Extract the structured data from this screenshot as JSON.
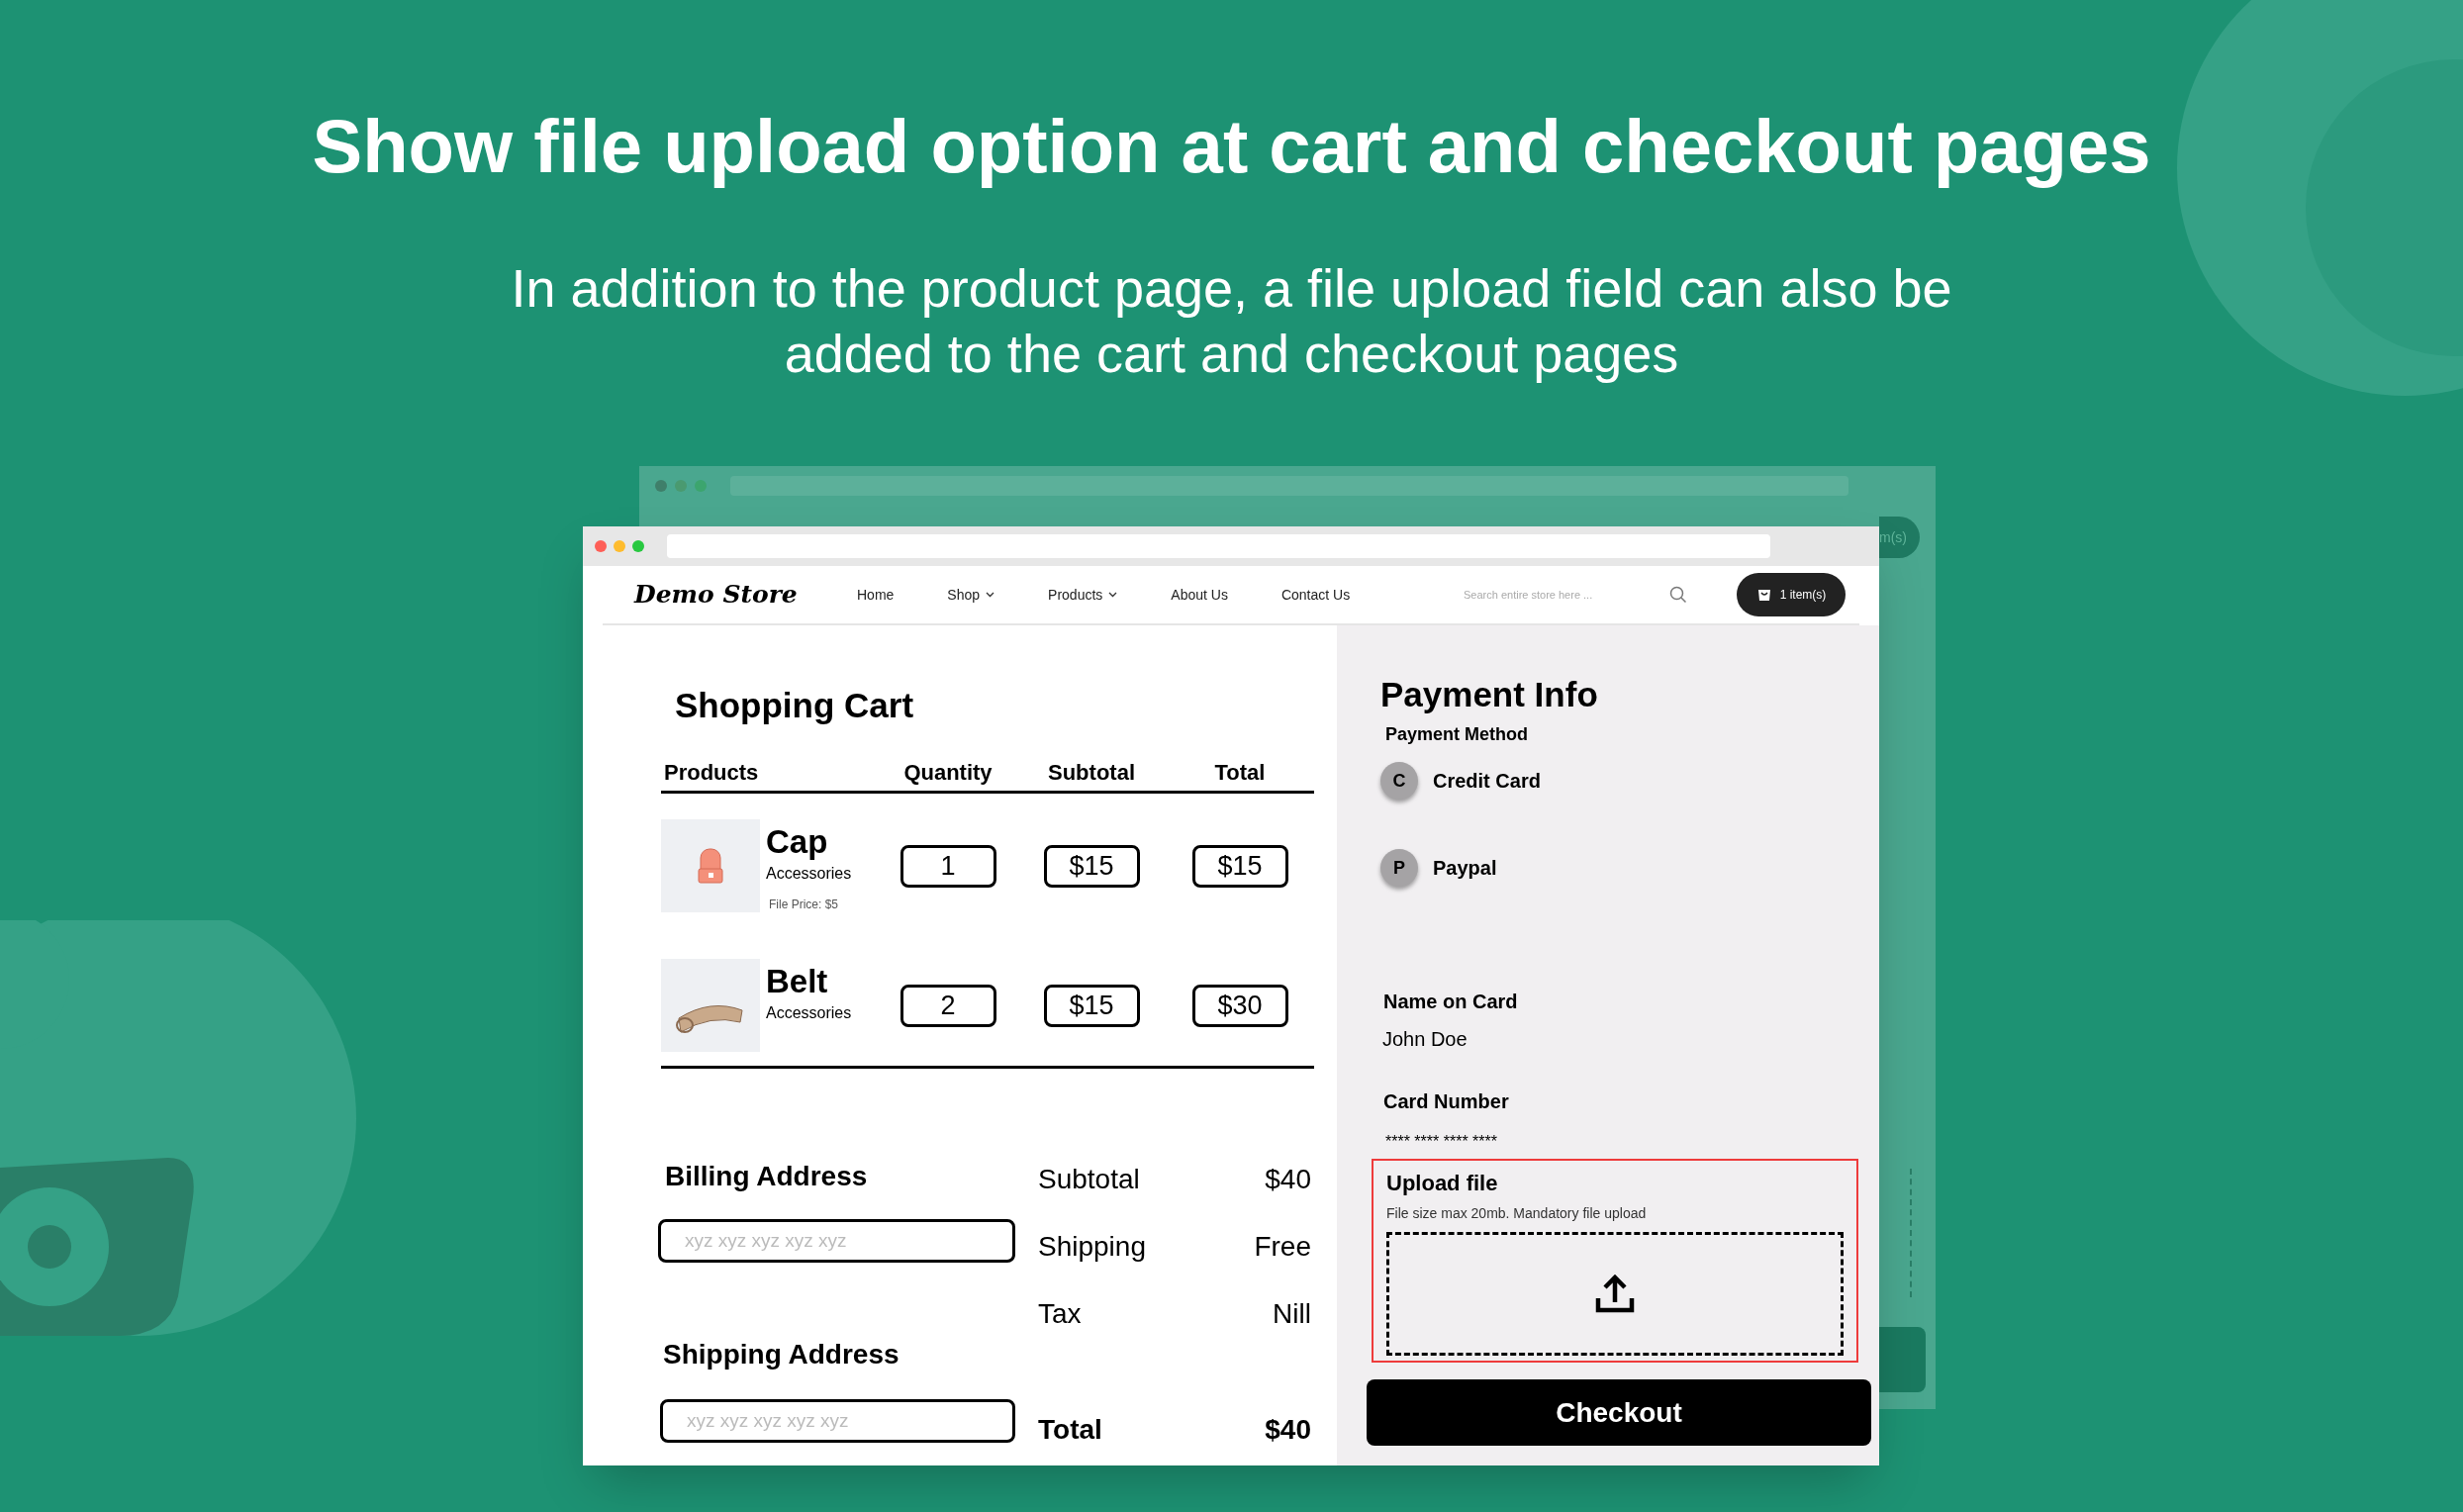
{
  "headline": "Show file upload option at cart and checkout pages",
  "subheadline": "In addition to the product page, a file upload field can also be added to the cart and checkout pages",
  "back_window": {
    "cart_label": "m(s)"
  },
  "store": {
    "logo": "Demo Store",
    "nav": [
      {
        "label": "Home",
        "dropdown": false
      },
      {
        "label": "Shop",
        "dropdown": true
      },
      {
        "label": "Products",
        "dropdown": true
      },
      {
        "label": "About Us",
        "dropdown": false
      },
      {
        "label": "Contact Us",
        "dropdown": false
      }
    ],
    "search_placeholder": "Search entire store here ...",
    "cart_label": "1 item(s)"
  },
  "cart": {
    "title": "Shopping Cart",
    "columns": [
      "Products",
      "Quantity",
      "Subtotal",
      "Total"
    ],
    "rows": [
      {
        "kind": "cap",
        "name": "Cap",
        "category": "Accessories",
        "file_price": "File Price: $5",
        "quantity": "1",
        "subtotal": "$15",
        "total": "$15"
      },
      {
        "kind": "belt",
        "name": "Belt",
        "category": "Accessories",
        "quantity": "2",
        "subtotal": "$15",
        "total": "$30"
      }
    ]
  },
  "billing": {
    "title": "Billing Address",
    "placeholder": "xyz xyz xyz xyz xyz"
  },
  "shipping": {
    "title": "Shipping Address",
    "placeholder": "xyz xyz xyz xyz xyz"
  },
  "summary": [
    {
      "label": "Subtotal",
      "value": "$40",
      "bold": false
    },
    {
      "label": "Shipping",
      "value": "Free",
      "bold": false
    },
    {
      "label": "Tax",
      "value": "Nill",
      "bold": false
    },
    {
      "label": "Total",
      "value": "$40",
      "bold": true
    }
  ],
  "payment": {
    "title": "Payment Info",
    "method_label": "Payment Method",
    "methods": [
      {
        "initial": "C",
        "label": "Credit Card"
      },
      {
        "initial": "P",
        "label": "Paypal"
      }
    ],
    "name_label": "Name on Card",
    "name_value": "John Doe",
    "card_label": "Card Number",
    "card_value": "**** **** **** ****",
    "upload": {
      "title": "Upload file",
      "hint": "File size max 20mb. Mandatory file upload"
    },
    "checkout": "Checkout"
  }
}
